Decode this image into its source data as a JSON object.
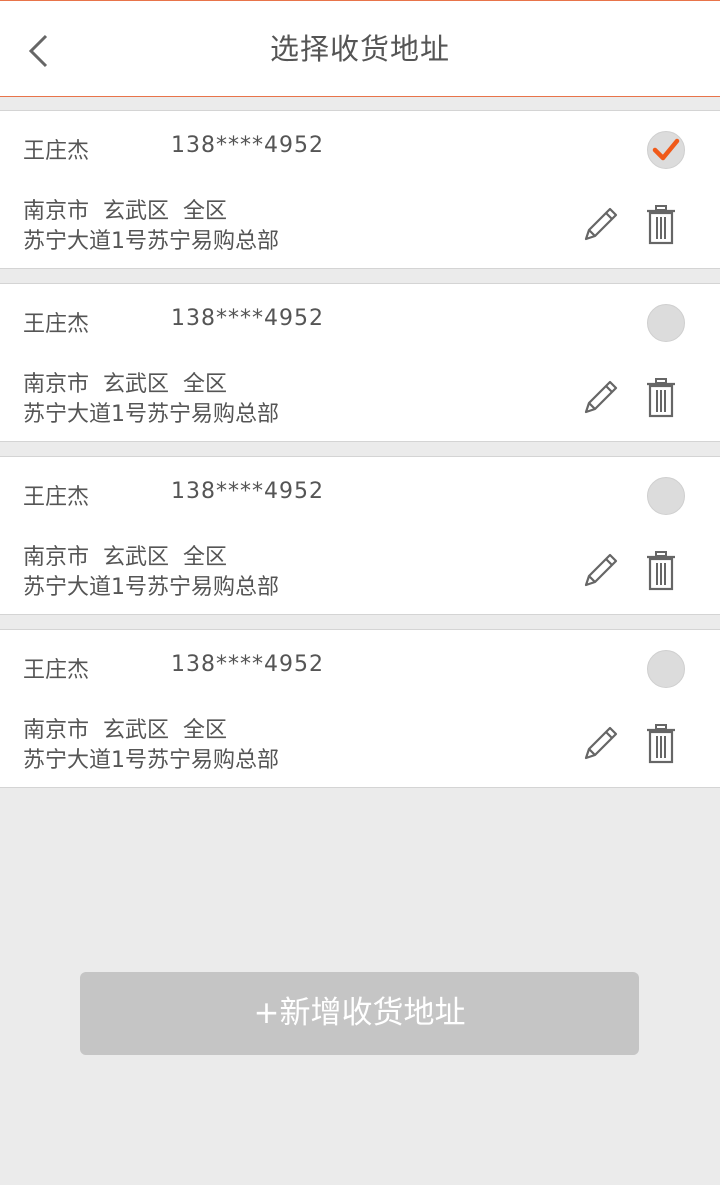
{
  "header": {
    "title": "选择收货地址",
    "back_icon": "chevron-left-icon"
  },
  "addresses": [
    {
      "name": "王庄杰",
      "phone": "138****4952",
      "region": "南京市  玄武区  全区",
      "street": "苏宁大道1号苏宁易购总部",
      "selected": true
    },
    {
      "name": "王庄杰",
      "phone": "138****4952",
      "region": "南京市  玄武区  全区",
      "street": "苏宁大道1号苏宁易购总部",
      "selected": false
    },
    {
      "name": "王庄杰",
      "phone": "138****4952",
      "region": "南京市  玄武区  全区",
      "street": "苏宁大道1号苏宁易购总部",
      "selected": false
    },
    {
      "name": "王庄杰",
      "phone": "138****4952",
      "region": "南京市  玄武区  全区",
      "street": "苏宁大道1号苏宁易购总部",
      "selected": false
    }
  ],
  "add_button": {
    "label": "+新增收货地址"
  },
  "icons": {
    "edit": "pencil-icon",
    "delete": "trash-icon",
    "selected": "checkmark-icon"
  },
  "colors": {
    "accent": "#f05a1a",
    "header_border": "#e8744a",
    "background": "#ebebeb",
    "button": "#c5c5c5"
  }
}
